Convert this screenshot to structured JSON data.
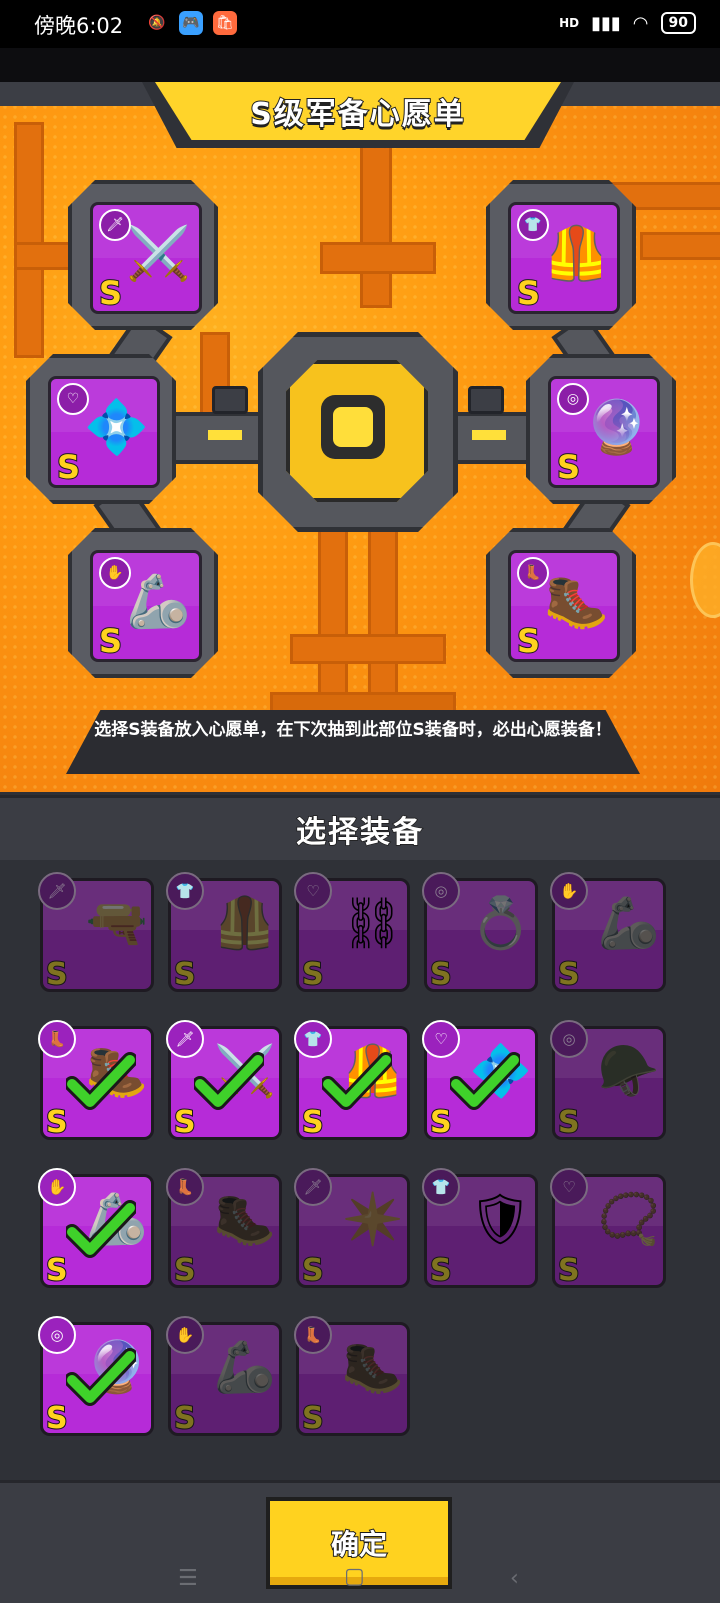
{
  "status_bar": {
    "time": "傍晚6:02",
    "network": "HD",
    "battery": "90"
  },
  "wishlist": {
    "title": "S级军备心愿单",
    "hint": "选择S装备放入心愿单，在下次抽到此部位S装备时，必出心愿装备！",
    "slots": [
      {
        "slot": "weapon",
        "rank": "S",
        "badge_icon": "dagger-icon",
        "art_icon": "sword-icon"
      },
      {
        "slot": "armor",
        "rank": "S",
        "badge_icon": "shirt-icon",
        "art_icon": "chest-armor-icon"
      },
      {
        "slot": "necklace",
        "rank": "S",
        "badge_icon": "necklace-icon",
        "art_icon": "star-necklace-icon"
      },
      {
        "slot": "belt",
        "rank": "S",
        "badge_icon": "belt-icon",
        "art_icon": "belt-item-icon"
      },
      {
        "slot": "gloves",
        "rank": "S",
        "badge_icon": "glove-icon",
        "art_icon": "gauntlet-icon"
      },
      {
        "slot": "boots",
        "rank": "S",
        "badge_icon": "boot-icon",
        "art_icon": "boot-item-icon"
      }
    ]
  },
  "select_section": {
    "title": "选择装备",
    "items": [
      {
        "slot": "weapon",
        "rank": "S",
        "selected": false,
        "badge_icon": "dagger-icon"
      },
      {
        "slot": "armor",
        "rank": "S",
        "selected": false,
        "badge_icon": "shirt-icon"
      },
      {
        "slot": "necklace",
        "rank": "S",
        "selected": false,
        "badge_icon": "necklace-icon"
      },
      {
        "slot": "belt",
        "rank": "S",
        "selected": false,
        "badge_icon": "belt-icon"
      },
      {
        "slot": "gloves",
        "rank": "S",
        "selected": false,
        "badge_icon": "glove-icon"
      },
      {
        "slot": "boots",
        "rank": "S",
        "selected": true,
        "badge_icon": "boot-icon"
      },
      {
        "slot": "weapon",
        "rank": "S",
        "selected": true,
        "badge_icon": "dagger-icon"
      },
      {
        "slot": "armor",
        "rank": "S",
        "selected": true,
        "badge_icon": "shirt-icon"
      },
      {
        "slot": "necklace",
        "rank": "S",
        "selected": true,
        "badge_icon": "necklace-icon"
      },
      {
        "slot": "belt",
        "rank": "S",
        "selected": false,
        "badge_icon": "belt-icon"
      },
      {
        "slot": "gloves",
        "rank": "S",
        "selected": true,
        "badge_icon": "glove-icon"
      },
      {
        "slot": "boots",
        "rank": "S",
        "selected": false,
        "badge_icon": "boot-icon"
      },
      {
        "slot": "weapon",
        "rank": "S",
        "selected": false,
        "badge_icon": "dagger-icon"
      },
      {
        "slot": "armor",
        "rank": "S",
        "selected": false,
        "badge_icon": "shirt-icon"
      },
      {
        "slot": "necklace",
        "rank": "S",
        "selected": false,
        "badge_icon": "necklace-icon"
      },
      {
        "slot": "belt",
        "rank": "S",
        "selected": true,
        "badge_icon": "belt-icon"
      },
      {
        "slot": "gloves",
        "rank": "S",
        "selected": false,
        "badge_icon": "glove-icon"
      },
      {
        "slot": "boots",
        "rank": "S",
        "selected": false,
        "badge_icon": "boot-icon"
      }
    ]
  },
  "footer": {
    "confirm_label": "确定"
  },
  "colors": {
    "accent_yellow": "#ffd21f",
    "equip_purple": "#b62bd8",
    "equip_purple_dim": "#5e1f72",
    "check_green": "#3fd12a",
    "background_orange": "#ff9c12"
  }
}
